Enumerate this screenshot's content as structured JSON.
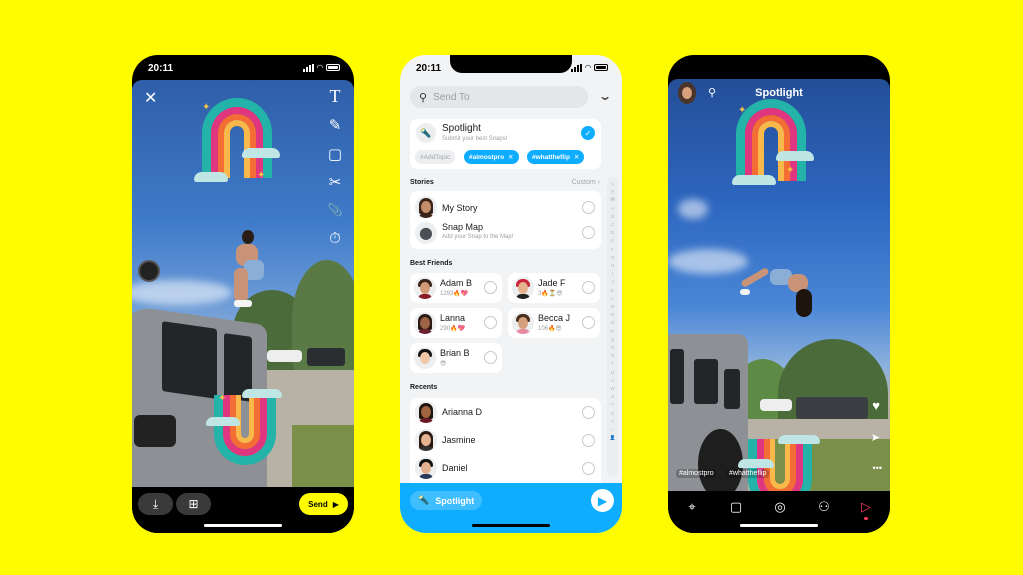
{
  "colors": {
    "background": "#FFFC00",
    "snap_blue": "#0EADFF",
    "spotlight_red": "#F23C57",
    "send_yellow": "#FFFC00"
  },
  "phone_editor": {
    "status_time": "20:11",
    "close_icon": "✕",
    "tools": [
      {
        "name": "text-tool",
        "glyph": "T"
      },
      {
        "name": "pencil-tool",
        "glyph": "✎"
      },
      {
        "name": "sticker-tool",
        "glyph": "▢"
      },
      {
        "name": "scissors-tool",
        "glyph": "✂"
      },
      {
        "name": "attachment-tool",
        "glyph": "📎"
      },
      {
        "name": "timer-tool",
        "glyph": "⏱"
      }
    ],
    "bottom": {
      "download_glyph": "⤓",
      "add_story_glyph": "⊞",
      "send_label": "Send",
      "send_glyph": "▶"
    }
  },
  "phone_send_to": {
    "status_time": "20:11",
    "search_placeholder": "Send To",
    "search_glyph": "⚲",
    "collapse_glyph": "⌄",
    "spotlight": {
      "title": "Spotlight",
      "subtitle": "Submit your best Snaps!",
      "checked": true,
      "tags": [
        {
          "label": "#AddTopic",
          "style": "plain"
        },
        {
          "label": "#almostpro",
          "style": "blue",
          "removable": true
        },
        {
          "label": "#whattheflip",
          "style": "blue",
          "removable": true
        }
      ]
    },
    "stories": {
      "heading": "Stories",
      "custom_label": "Custom ›",
      "items": [
        {
          "name": "My Story",
          "subtitle": ""
        },
        {
          "name": "Snap Map",
          "subtitle": "Add your Snap to the Map!"
        }
      ]
    },
    "best_friends": {
      "heading": "Best Friends",
      "items": [
        {
          "name": "Adam B",
          "streak": "1293🔥💖"
        },
        {
          "name": "Jade F",
          "streak": "3🔥⏳😎"
        },
        {
          "name": "Lanna",
          "streak": "290🔥💖"
        },
        {
          "name": "Becca J",
          "streak": "106🔥😎"
        },
        {
          "name": "Brian B",
          "streak": "😎"
        }
      ]
    },
    "recents": {
      "heading": "Recents",
      "items": [
        {
          "name": "Arianna D"
        },
        {
          "name": "Jasmine"
        },
        {
          "name": "Daniel"
        }
      ]
    },
    "alpha_index": [
      "☺",
      "◷",
      "👁",
      "A",
      "B",
      "C",
      "D",
      "E",
      "F",
      "G",
      "H",
      "I",
      "J",
      "K",
      "L",
      "M",
      "N",
      "O",
      "P",
      "Q",
      "R",
      "S",
      "T",
      "U",
      "V",
      "W",
      "X",
      "Y",
      "Z",
      "#",
      "☆",
      "👤"
    ],
    "bottom": {
      "selected_label": "Spotlight",
      "send_glyph": "▶"
    }
  },
  "phone_spotlight": {
    "title": "Spotlight",
    "search_glyph": "⚲",
    "hashtags": [
      "#almostpro",
      "#whattheflip"
    ],
    "actions": [
      {
        "name": "heart",
        "glyph": "♥"
      },
      {
        "name": "share",
        "glyph": "➤"
      },
      {
        "name": "more",
        "glyph": "•••"
      }
    ],
    "nav": [
      {
        "name": "map",
        "glyph": "⌖"
      },
      {
        "name": "chat",
        "glyph": "▢"
      },
      {
        "name": "camera",
        "glyph": "◎"
      },
      {
        "name": "friends",
        "glyph": "⚇"
      },
      {
        "name": "spotlight",
        "glyph": "▷",
        "active": true
      }
    ]
  }
}
